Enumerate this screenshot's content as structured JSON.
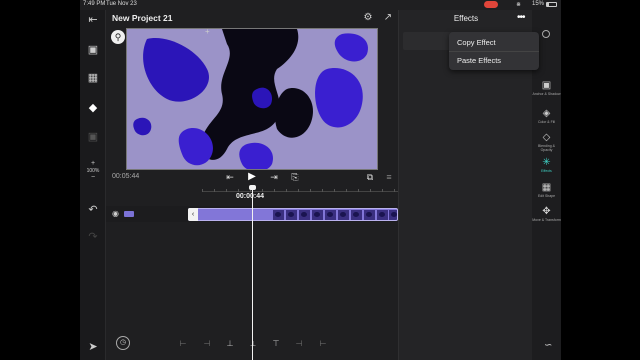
{
  "status_bar": {
    "time": "7:49 PM",
    "date": "Tue Nov 23",
    "battery": "15%",
    "record_color": "#e0453a"
  },
  "left_toolbar": {
    "icons": [
      "back-icon",
      "aspect-ratio-icon",
      "grid-icon",
      "layers-icon",
      "camera-icon"
    ],
    "zoom_plus": "+",
    "zoom_level": "100%",
    "zoom_minus": "−",
    "undo_icon": "undo-icon",
    "redo_icon": "redo-icon",
    "export_icon": "send-icon"
  },
  "header": {
    "project_title": "New Project 21",
    "settings_icon": "gear-icon",
    "share_icon": "share-icon"
  },
  "preview": {
    "zoom_icon": "magnifier-icon",
    "colors": {
      "background": "#9b93c8",
      "blob": "#3a1fd0",
      "dark": "#0a0814"
    }
  },
  "transport": {
    "current_time": "00:05:44",
    "skip_back_icon": "skip-to-start-icon",
    "play_icon": "play-icon",
    "skip_forward_icon": "skip-to-end-icon",
    "bookmark_icon": "bookmark-icon",
    "copy_icon": "duplicate-icon",
    "align_icon": "snap-icon"
  },
  "timeline": {
    "playhead_time": "00:00:44",
    "clip_color": "#8276d8",
    "visibility_icon": "eye-icon"
  },
  "bottom_toolbar": {
    "speed_icon": "speedometer-icon",
    "tools": [
      "trim-left-icon",
      "split-left-icon",
      "split-icon",
      "split-center-icon",
      "split-right-icon",
      "trim-right-icon",
      "ripple-icon"
    ]
  },
  "effects_panel": {
    "title": "Effects",
    "more_icon": "more-icon",
    "close_icon": "close-icon",
    "add_icon": "plus-icon",
    "menu": {
      "copy": "Copy Effect",
      "paste": "Paste Effects"
    }
  },
  "right_toolbar": {
    "items": [
      {
        "label": "Anchor & Shadow",
        "icon": "anchor-icon",
        "active": false
      },
      {
        "label": "Color & Fill",
        "icon": "color-fill-icon",
        "active": false
      },
      {
        "label": "Blending & Opacity",
        "icon": "blending-icon",
        "active": false
      },
      {
        "label": "Effects",
        "icon": "effects-icon",
        "active": true
      },
      {
        "label": "Edit Shape",
        "icon": "edit-shape-icon",
        "active": false
      },
      {
        "label": "Move & Transform",
        "icon": "move-icon",
        "active": false
      }
    ],
    "accent_color": "#3fd0c4",
    "bottom_icon": "motion-icon"
  }
}
